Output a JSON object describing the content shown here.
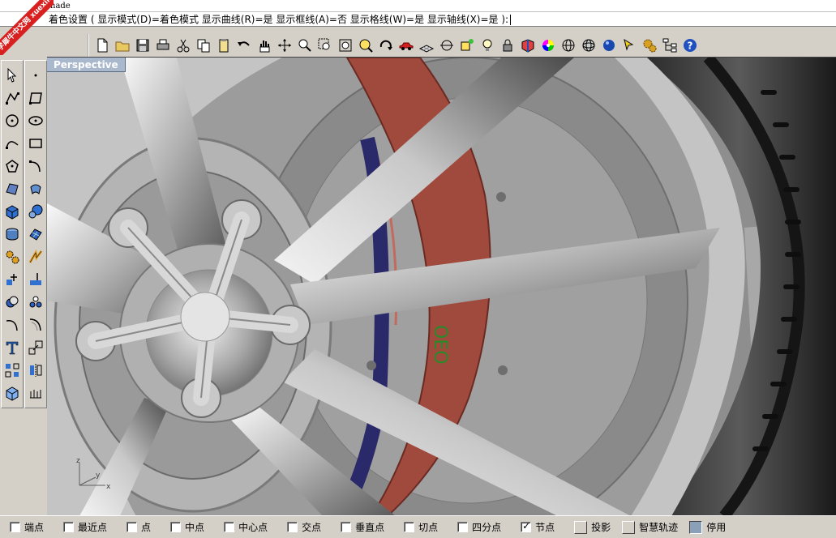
{
  "command": {
    "history": "hade",
    "prompt": "着色设置 ( 显示模式(D)=着色模式 显示曲线(R)=是 显示框线(A)=否 显示格线(W)=是 显示轴线(X)=是 ):"
  },
  "watermark": {
    "text": "学犀牛中文网 xuexiniu"
  },
  "viewport": {
    "title": "Perspective"
  },
  "axis": {
    "z": "z",
    "y": "y",
    "x": "x"
  },
  "colors": {
    "caliper": "#a04a3e",
    "disc_inner": "#2a2a6a",
    "tab_bg": "#a9b8cc",
    "tire": "#2e2e2e"
  },
  "top_toolbar": [
    "new-file-icon",
    "open-folder-icon",
    "save-icon",
    "print-icon",
    "cut-icon",
    "copy-icon",
    "paste-icon",
    "undo-icon",
    "pan-hand-icon",
    "rotate-view-icon",
    "zoom-in-icon",
    "zoom-window-icon",
    "zoom-extents-icon",
    "zoom-selected-icon",
    "rotate-camera-icon",
    "car-icon",
    "grid-plane-icon",
    "cplane-icon",
    "snap-point-icon",
    "light-icon",
    "lock-icon",
    "render-icon",
    "color-wheel-icon",
    "sphere-wire-icon",
    "sphere-mesh-icon",
    "sphere-render-icon",
    "arrow-select-icon",
    "gears-icon",
    "hierarchy-icon",
    "help-icon"
  ],
  "left_toolbar_1": [
    "select-arrow-icon",
    "polyline-icon",
    "circle-icon",
    "curve-icon",
    "polygon-icon",
    "surface-icon",
    "box-solid-icon",
    "extrude-icon",
    "tools-icon",
    "transform-icon",
    "boolean-icon",
    "fillet-curve-icon",
    "text-icon",
    "array-icon",
    "render-box-icon"
  ],
  "left_toolbar_2": [
    "point-icon",
    "rectangle-icon",
    "ellipse-icon",
    "rect-curve-icon",
    "arc-icon",
    "sweep-icon",
    "sphere-solid-icon",
    "surface-patch-icon",
    "lightning-icon",
    "split-icon",
    "points-group-icon",
    "fillet-edge-icon",
    "scale-icon",
    "mirror-icon",
    "dimension-icon"
  ],
  "status_bar": {
    "snaps": [
      {
        "label": "端点",
        "checked": false
      },
      {
        "label": "最近点",
        "checked": false
      },
      {
        "label": "点",
        "checked": false
      },
      {
        "label": "中点",
        "checked": false
      },
      {
        "label": "中心点",
        "checked": false
      },
      {
        "label": "交点",
        "checked": false
      },
      {
        "label": "垂直点",
        "checked": false
      },
      {
        "label": "切点",
        "checked": false
      },
      {
        "label": "四分点",
        "checked": false
      },
      {
        "label": "节点",
        "checked": true
      }
    ],
    "buttons": [
      {
        "label": "投影",
        "pressed": false
      },
      {
        "label": "智慧轨迹",
        "pressed": false
      },
      {
        "label": "停用",
        "pressed": true
      }
    ]
  }
}
